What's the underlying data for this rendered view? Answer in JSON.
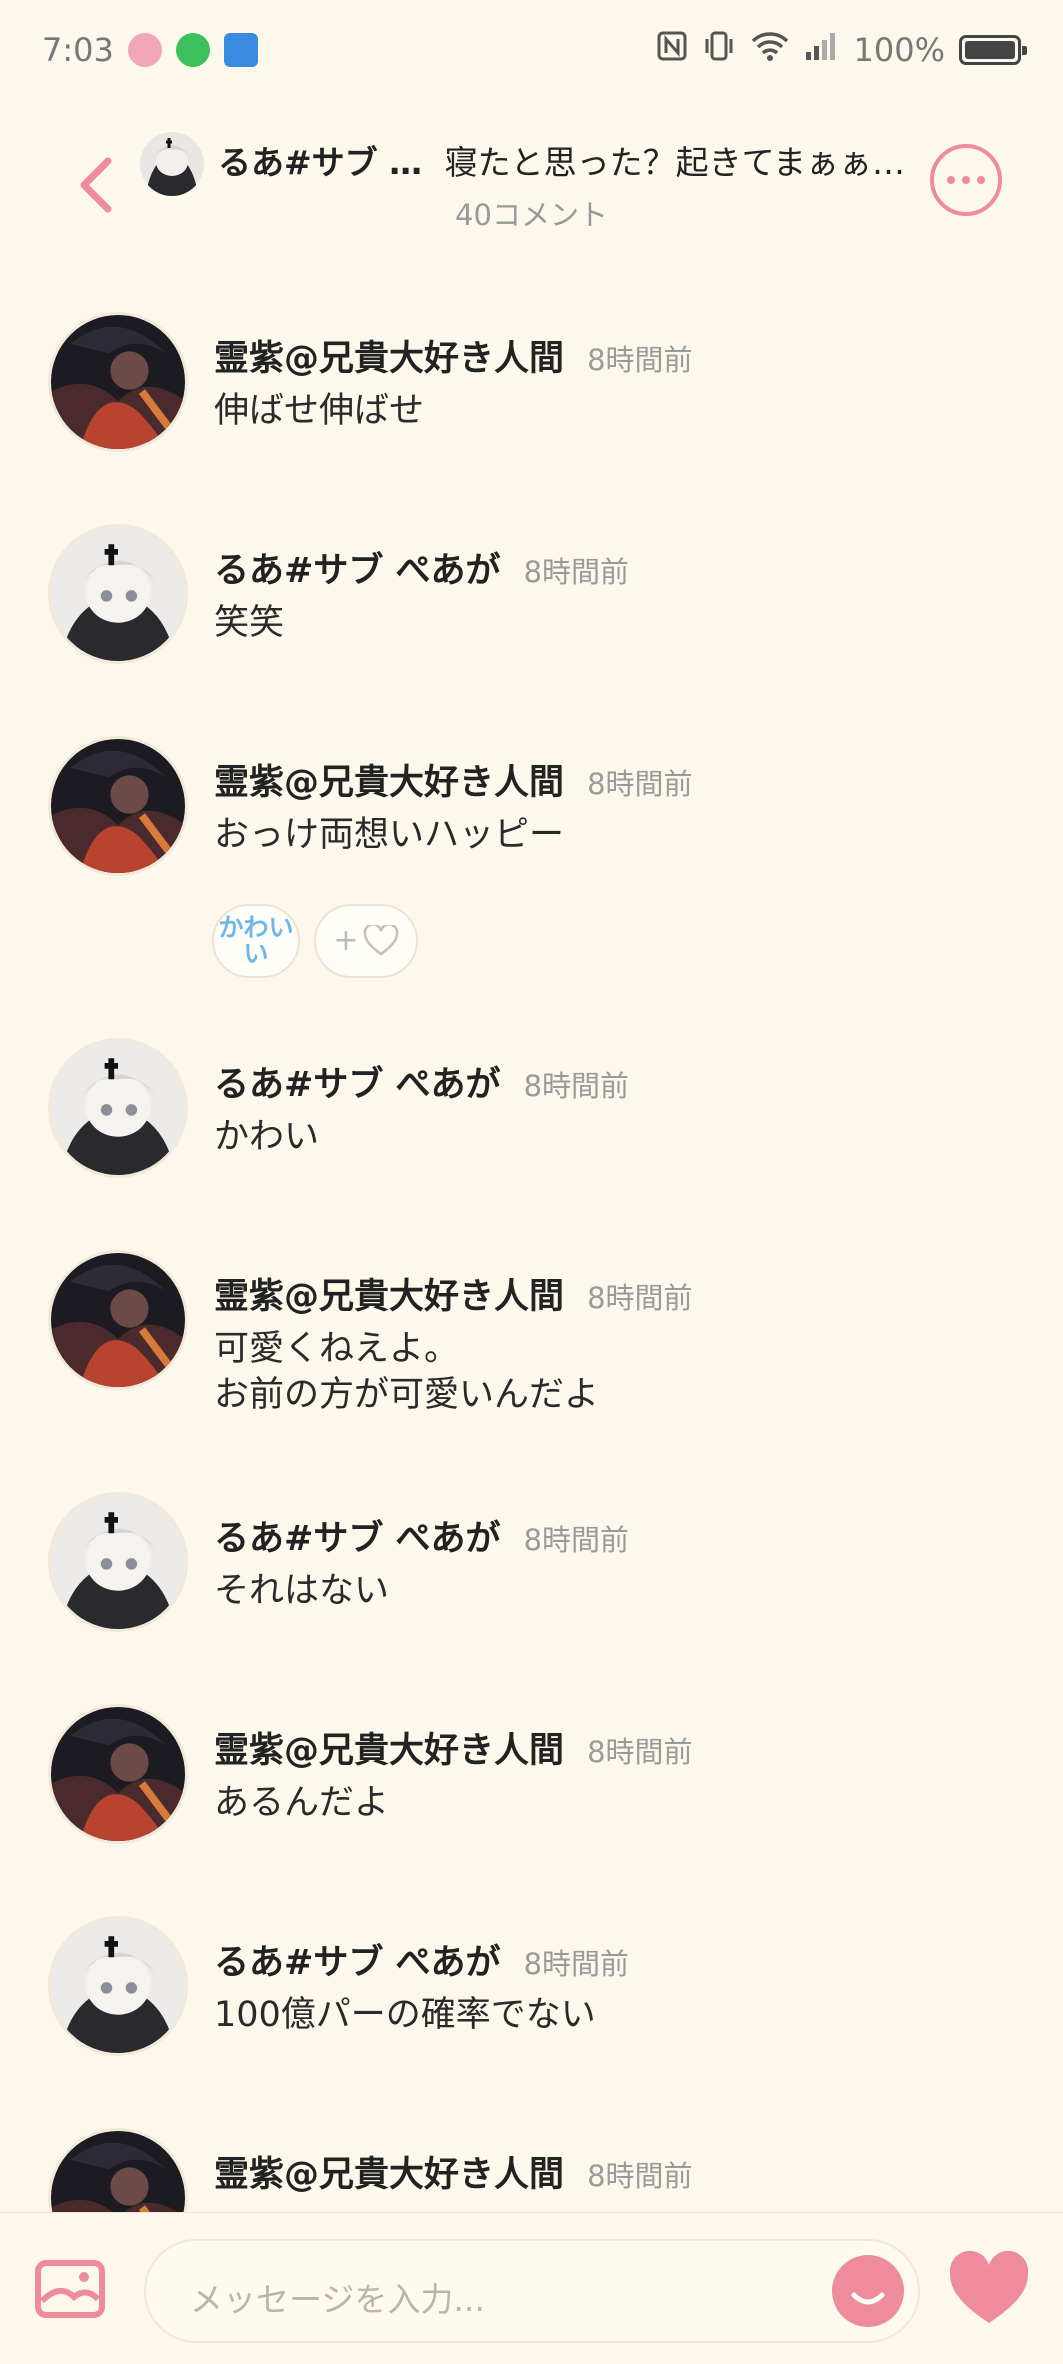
{
  "status_bar": {
    "time": "7:03",
    "battery": "100%"
  },
  "header": {
    "poster_name": "るあ#サブ …",
    "post_title": "寝たと思った？起きてまぁぁ…",
    "comment_count": "40コメント"
  },
  "comments": [
    {
      "user": "霊紫@兄貴大好き人間",
      "time": "8時間前",
      "text": "伸ばせ伸ばせ",
      "avatar": "dark"
    },
    {
      "user": "るあ#サブ ぺあが",
      "time": "8時間前",
      "text": "笑笑",
      "avatar": "light"
    },
    {
      "user": "霊紫@兄貴大好き人間",
      "time": "8時間前",
      "text": "おっけ両想いハッピー",
      "avatar": "dark",
      "reactions": {
        "stamp": "かわいい",
        "add": "+"
      }
    },
    {
      "user": "るあ#サブ ぺあが",
      "time": "8時間前",
      "text": "かわい",
      "avatar": "light"
    },
    {
      "user": "霊紫@兄貴大好き人間",
      "time": "8時間前",
      "text": "可愛くねえよ。\nお前の方が可愛いんだよ",
      "avatar": "dark"
    },
    {
      "user": "るあ#サブ ぺあが",
      "time": "8時間前",
      "text": "それはない",
      "avatar": "light"
    },
    {
      "user": "霊紫@兄貴大好き人間",
      "time": "8時間前",
      "text": "あるんだよ",
      "avatar": "dark"
    },
    {
      "user": "るあ#サブ ぺあが",
      "time": "8時間前",
      "text": "100億パーの確率でない",
      "avatar": "light"
    },
    {
      "user": "霊紫@兄貴大好き人間",
      "time": "8時間前",
      "text": "",
      "avatar": "dark"
    }
  ],
  "input": {
    "placeholder": "メッセージを入力..."
  },
  "colors": {
    "background": "#fdf8ec",
    "accent": "#ee8c9b",
    "reaction_text": "#6fb7e8"
  },
  "icons": [
    "back-icon",
    "more-icon",
    "image-icon",
    "smile-icon",
    "heart-icon"
  ]
}
